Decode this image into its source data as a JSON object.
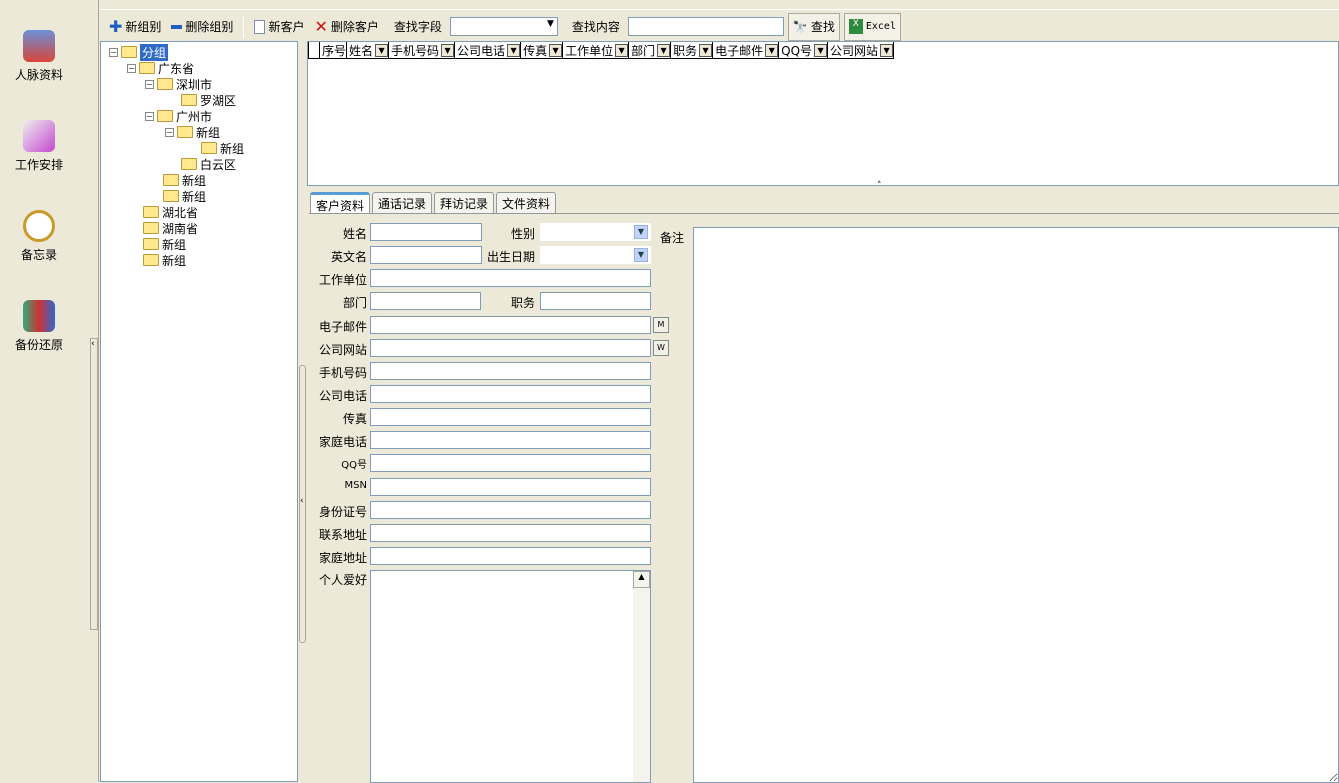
{
  "sidebar": {
    "items": [
      {
        "label": "人脉资料",
        "icon": "contacts-icon"
      },
      {
        "label": "工作安排",
        "icon": "schedule-icon"
      },
      {
        "label": "备忘录",
        "icon": "alarm-clock-icon"
      },
      {
        "label": "备份还原",
        "icon": "backup-tools-icon"
      }
    ]
  },
  "toolbar": {
    "new_group": "新组别",
    "delete_group": "删除组别",
    "new_customer": "新客户",
    "delete_customer": "删除客户",
    "search_field_label": "查找字段",
    "search_field_value": "",
    "search_content_label": "查找内容",
    "search_content_value": "",
    "search_button": "查找",
    "excel_button": "Excel"
  },
  "tree": {
    "nodes": [
      {
        "label": "分组",
        "level": 0
      },
      {
        "label": "广东省",
        "level": 1
      },
      {
        "label": "深圳市",
        "level": 2
      },
      {
        "label": "罗湖区",
        "level": 3
      },
      {
        "label": "广州市",
        "level": 2
      },
      {
        "label": "新组",
        "level": 3
      },
      {
        "label": "新组",
        "level": 4
      },
      {
        "label": "白云区",
        "level": 3
      },
      {
        "label": "新组",
        "level": 2
      },
      {
        "label": "新组",
        "level": 2
      },
      {
        "label": "湖北省",
        "level": 1
      },
      {
        "label": "湖南省",
        "level": 1
      },
      {
        "label": "新组",
        "level": 1
      },
      {
        "label": "新组",
        "level": 1
      }
    ]
  },
  "grid": {
    "columns": [
      "序号",
      "姓名",
      "手机号码",
      "公司电话",
      "传真",
      "工作单位",
      "部门",
      "职务",
      "电子邮件",
      "QQ号",
      "公司网站"
    ]
  },
  "tabs": [
    "客户资料",
    "通话记录",
    "拜访记录",
    "文件资料"
  ],
  "form": {
    "name": "姓名",
    "gender": "性别",
    "english_name": "英文名",
    "birthday": "出生日期",
    "company": "工作单位",
    "department": "部门",
    "position": "职务",
    "email": "电子邮件",
    "email_btn": "M",
    "website": "公司网站",
    "website_btn": "W",
    "mobile": "手机号码",
    "company_phone": "公司电话",
    "fax": "传真",
    "home_phone": "家庭电话",
    "qq": "QQ号",
    "msn": "MSN",
    "id_number": "身份证号",
    "address": "联系地址",
    "home_address": "家庭地址",
    "hobby": "个人爱好",
    "notes": "备注"
  }
}
